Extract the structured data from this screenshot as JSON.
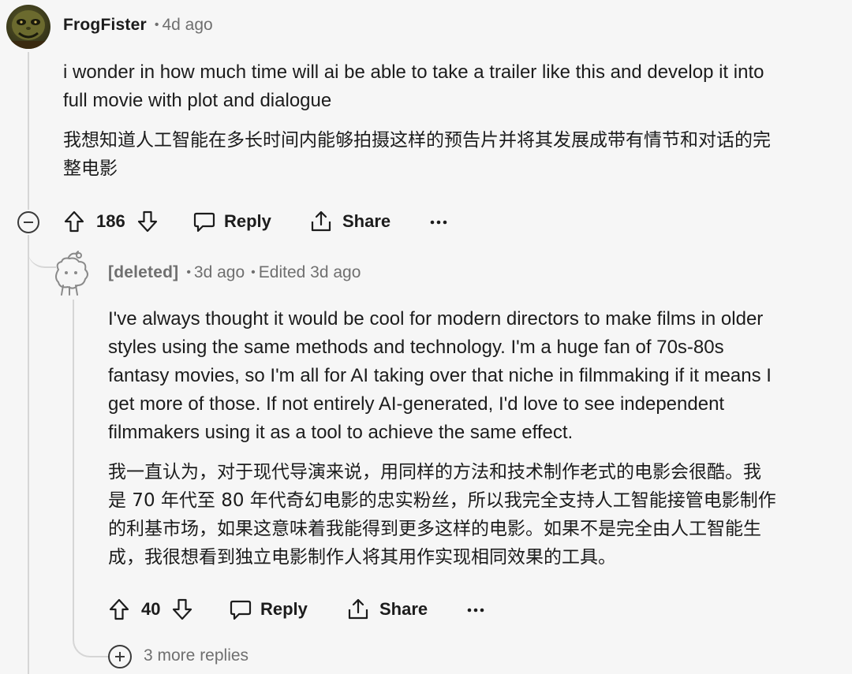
{
  "comment": {
    "author": "FrogFister",
    "age": "4d ago",
    "text_en": "i wonder in how much time will ai be able to take a trailer like this and develop it into\nfull movie with plot and dialogue",
    "text_cn": "我想知道人工智能在多长时间内能够拍摄这样的预告片并将其发展成带有情节和对话的完\n整电影",
    "votes": "186",
    "reply_label": "Reply",
    "share_label": "Share"
  },
  "reply": {
    "author": "[deleted]",
    "age": "3d ago",
    "edited": "Edited 3d ago",
    "text_en": "I've always thought it would be cool for modern directors to make films in older\nstyles using the same methods and technology. I'm a huge fan of 70s-80s\nfantasy movies, so I'm all for AI taking over that niche in filmmaking if it means I\nget more of those. If not entirely AI-generated, I'd love to see independent\nfilmmakers using it as a tool to achieve the same effect.",
    "text_cn": "我一直认为，对于现代导演来说，用同样的方法和技术制作老式的电影会很酷。我\n是 70 年代至 80 年代奇幻电影的忠实粉丝，所以我完全支持人工智能接管电影制作\n的利基市场，如果这意味着我能得到更多这样的电影。如果不是完全由人工智能生\n成，我很想看到独立电影制作人将其用作实现相同效果的工具。",
    "votes": "40",
    "reply_label": "Reply",
    "share_label": "Share"
  },
  "more_replies": "3 more replies",
  "icons": {
    "upvote": "upvote-arrow-icon",
    "downvote": "downvote-arrow-icon",
    "reply": "speech-bubble-icon",
    "share": "share-icon",
    "overflow": "more-horizontal-icon",
    "collapse": "collapse-minus-icon",
    "expand": "expand-plus-icon"
  }
}
